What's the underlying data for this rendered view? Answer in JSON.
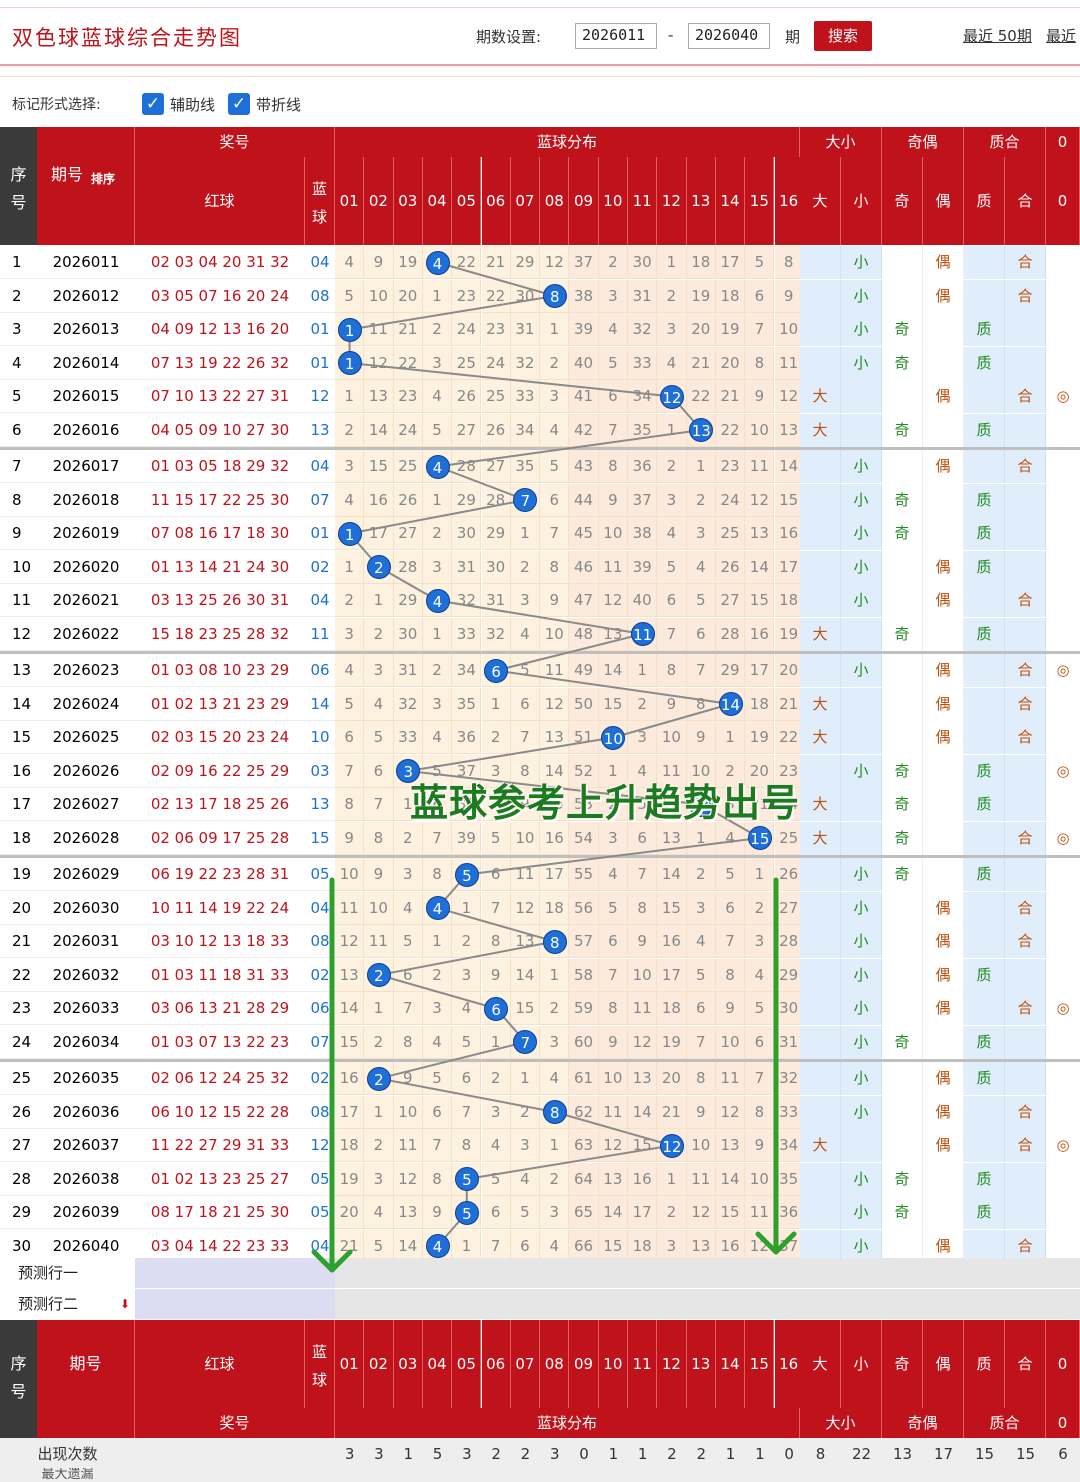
{
  "header": {
    "title": "双色球蓝球综合走势图",
    "period_label": "期数设置:",
    "from_value": "2026011",
    "dash": "-",
    "to_value": "2026040",
    "unit": "期",
    "search_label": "搜索",
    "recent_50": "最近 50期",
    "recent_more": "最近"
  },
  "marks": {
    "label": "标记形式选择:",
    "aux_label": "辅助线",
    "fold_label": "带折线"
  },
  "table_header": {
    "seq": "序号",
    "period": "期号",
    "sort": "排序",
    "prize": "奖号",
    "red": "红球",
    "blue": "蓝球",
    "dist": "蓝球分布",
    "size": "大小",
    "parity": "奇偶",
    "primality": "质合",
    "zero_col": "0",
    "big": "大",
    "small": "小",
    "odd": "奇",
    "even": "偶",
    "prime": "质",
    "comp": "合",
    "col_numbers": [
      "01",
      "02",
      "03",
      "04",
      "05",
      "06",
      "07",
      "08",
      "09",
      "10",
      "11",
      "12",
      "13",
      "14",
      "15",
      "16"
    ]
  },
  "rows": [
    {
      "seq": "1",
      "period": "2026011",
      "red": "02 03 04 20 31 32",
      "blue": "04",
      "dist": [
        "4",
        "9",
        "19",
        "4",
        "22",
        "21",
        "29",
        "12",
        "37",
        "2",
        "30",
        "1",
        "18",
        "17",
        "5",
        "8"
      ],
      "size": "小",
      "parity": "偶",
      "prime": "合",
      "z": ""
    },
    {
      "seq": "2",
      "period": "2026012",
      "red": "03 05 07 16 20 24",
      "blue": "08",
      "dist": [
        "5",
        "10",
        "20",
        "1",
        "23",
        "22",
        "30",
        "8",
        "38",
        "3",
        "31",
        "2",
        "19",
        "18",
        "6",
        "9"
      ],
      "size": "小",
      "parity": "偶",
      "prime": "合",
      "z": ""
    },
    {
      "seq": "3",
      "period": "2026013",
      "red": "04 09 12 13 16 20",
      "blue": "01",
      "dist": [
        "1",
        "11",
        "21",
        "2",
        "24",
        "23",
        "31",
        "1",
        "39",
        "4",
        "32",
        "3",
        "20",
        "19",
        "7",
        "10"
      ],
      "size": "小",
      "parity": "奇",
      "prime": "质",
      "z": ""
    },
    {
      "seq": "4",
      "period": "2026014",
      "red": "07 13 19 22 26 32",
      "blue": "01",
      "dist": [
        "1",
        "12",
        "22",
        "3",
        "25",
        "24",
        "32",
        "2",
        "40",
        "5",
        "33",
        "4",
        "21",
        "20",
        "8",
        "11"
      ],
      "size": "小",
      "parity": "奇",
      "prime": "质",
      "z": ""
    },
    {
      "seq": "5",
      "period": "2026015",
      "red": "07 10 13 22 27 31",
      "blue": "12",
      "dist": [
        "1",
        "13",
        "23",
        "4",
        "26",
        "25",
        "33",
        "3",
        "41",
        "6",
        "34",
        "12",
        "22",
        "21",
        "9",
        "12"
      ],
      "size": "大",
      "parity": "偶",
      "prime": "合",
      "z": "◎"
    },
    {
      "seq": "6",
      "period": "2026016",
      "red": "04 05 09 10 27 30",
      "blue": "13",
      "dist": [
        "2",
        "14",
        "24",
        "5",
        "27",
        "26",
        "34",
        "4",
        "42",
        "7",
        "35",
        "1",
        "13",
        "22",
        "10",
        "13"
      ],
      "size": "大",
      "parity": "奇",
      "prime": "质",
      "z": ""
    },
    {
      "seq": "7",
      "period": "2026017",
      "red": "01 03 05 18 29 32",
      "blue": "04",
      "dist": [
        "3",
        "15",
        "25",
        "4",
        "28",
        "27",
        "35",
        "5",
        "43",
        "8",
        "36",
        "2",
        "1",
        "23",
        "11",
        "14"
      ],
      "size": "小",
      "parity": "偶",
      "prime": "合",
      "z": ""
    },
    {
      "seq": "8",
      "period": "2026018",
      "red": "11 15 17 22 25 30",
      "blue": "07",
      "dist": [
        "4",
        "16",
        "26",
        "1",
        "29",
        "28",
        "7",
        "6",
        "44",
        "9",
        "37",
        "3",
        "2",
        "24",
        "12",
        "15"
      ],
      "size": "小",
      "parity": "奇",
      "prime": "质",
      "z": ""
    },
    {
      "seq": "9",
      "period": "2026019",
      "red": "07 08 16 17 18 30",
      "blue": "01",
      "dist": [
        "1",
        "17",
        "27",
        "2",
        "30",
        "29",
        "1",
        "7",
        "45",
        "10",
        "38",
        "4",
        "3",
        "25",
        "13",
        "16"
      ],
      "size": "小",
      "parity": "奇",
      "prime": "质",
      "z": ""
    },
    {
      "seq": "10",
      "period": "2026020",
      "red": "01 13 14 21 24 30",
      "blue": "02",
      "dist": [
        "1",
        "2",
        "28",
        "3",
        "31",
        "30",
        "2",
        "8",
        "46",
        "11",
        "39",
        "5",
        "4",
        "26",
        "14",
        "17"
      ],
      "size": "小",
      "parity": "偶",
      "prime": "质",
      "z": ""
    },
    {
      "seq": "11",
      "period": "2026021",
      "red": "03 13 25 26 30 31",
      "blue": "04",
      "dist": [
        "2",
        "1",
        "29",
        "4",
        "32",
        "31",
        "3",
        "9",
        "47",
        "12",
        "40",
        "6",
        "5",
        "27",
        "15",
        "18"
      ],
      "size": "小",
      "parity": "偶",
      "prime": "合",
      "z": ""
    },
    {
      "seq": "12",
      "period": "2026022",
      "red": "15 18 23 25 28 32",
      "blue": "11",
      "dist": [
        "3",
        "2",
        "30",
        "1",
        "33",
        "32",
        "4",
        "10",
        "48",
        "13",
        "11",
        "7",
        "6",
        "28",
        "16",
        "19"
      ],
      "size": "大",
      "parity": "奇",
      "prime": "质",
      "z": ""
    },
    {
      "seq": "13",
      "period": "2026023",
      "red": "01 03 08 10 23 29",
      "blue": "06",
      "dist": [
        "4",
        "3",
        "31",
        "2",
        "34",
        "6",
        "5",
        "11",
        "49",
        "14",
        "1",
        "8",
        "7",
        "29",
        "17",
        "20"
      ],
      "size": "小",
      "parity": "偶",
      "prime": "合",
      "z": "◎"
    },
    {
      "seq": "14",
      "period": "2026024",
      "red": "01 02 13 21 23 29",
      "blue": "14",
      "dist": [
        "5",
        "4",
        "32",
        "3",
        "35",
        "1",
        "6",
        "12",
        "50",
        "15",
        "2",
        "9",
        "8",
        "14",
        "18",
        "21"
      ],
      "size": "大",
      "parity": "偶",
      "prime": "合",
      "z": ""
    },
    {
      "seq": "15",
      "period": "2026025",
      "red": "02 03 15 20 23 24",
      "blue": "10",
      "dist": [
        "6",
        "5",
        "33",
        "4",
        "36",
        "2",
        "7",
        "13",
        "51",
        "10",
        "3",
        "10",
        "9",
        "1",
        "19",
        "22"
      ],
      "size": "大",
      "parity": "偶",
      "prime": "合",
      "z": ""
    },
    {
      "seq": "16",
      "period": "2026026",
      "red": "02 09 16 22 25 29",
      "blue": "03",
      "dist": [
        "7",
        "6",
        "3",
        "5",
        "37",
        "3",
        "8",
        "14",
        "52",
        "1",
        "4",
        "11",
        "10",
        "2",
        "20",
        "23"
      ],
      "size": "小",
      "parity": "奇",
      "prime": "质",
      "z": "◎"
    },
    {
      "seq": "17",
      "period": "2026027",
      "red": "02 13 17 18 25 26",
      "blue": "13",
      "dist": [
        "8",
        "7",
        "1",
        "6",
        "38",
        "4",
        "9",
        "15",
        "53",
        "2",
        "5",
        "12",
        "13",
        "3",
        "21",
        "24"
      ],
      "size": "大",
      "parity": "奇",
      "prime": "质",
      "z": ""
    },
    {
      "seq": "18",
      "period": "2026028",
      "red": "02 06 09 17 25 28",
      "blue": "15",
      "dist": [
        "9",
        "8",
        "2",
        "7",
        "39",
        "5",
        "10",
        "16",
        "54",
        "3",
        "6",
        "13",
        "1",
        "4",
        "15",
        "25"
      ],
      "size": "大",
      "parity": "奇",
      "prime": "合",
      "z": "◎"
    },
    {
      "seq": "19",
      "period": "2026029",
      "red": "06 19 22 23 28 31",
      "blue": "05",
      "dist": [
        "10",
        "9",
        "3",
        "8",
        "5",
        "6",
        "11",
        "17",
        "55",
        "4",
        "7",
        "14",
        "2",
        "5",
        "1",
        "26"
      ],
      "size": "小",
      "parity": "奇",
      "prime": "质",
      "z": ""
    },
    {
      "seq": "20",
      "period": "2026030",
      "red": "10 11 14 19 22 24",
      "blue": "04",
      "dist": [
        "11",
        "10",
        "4",
        "4",
        "1",
        "7",
        "12",
        "18",
        "56",
        "5",
        "8",
        "15",
        "3",
        "6",
        "2",
        "27"
      ],
      "size": "小",
      "parity": "偶",
      "prime": "合",
      "z": ""
    },
    {
      "seq": "21",
      "period": "2026031",
      "red": "03 10 12 13 18 33",
      "blue": "08",
      "dist": [
        "12",
        "11",
        "5",
        "1",
        "2",
        "8",
        "13",
        "8",
        "57",
        "6",
        "9",
        "16",
        "4",
        "7",
        "3",
        "28"
      ],
      "size": "小",
      "parity": "偶",
      "prime": "合",
      "z": ""
    },
    {
      "seq": "22",
      "period": "2026032",
      "red": "01 03 11 18 31 33",
      "blue": "02",
      "dist": [
        "13",
        "2",
        "6",
        "2",
        "3",
        "9",
        "14",
        "1",
        "58",
        "7",
        "10",
        "17",
        "5",
        "8",
        "4",
        "29"
      ],
      "size": "小",
      "parity": "偶",
      "prime": "质",
      "z": ""
    },
    {
      "seq": "23",
      "period": "2026033",
      "red": "03 06 13 21 28 29",
      "blue": "06",
      "dist": [
        "14",
        "1",
        "7",
        "3",
        "4",
        "6",
        "15",
        "2",
        "59",
        "8",
        "11",
        "18",
        "6",
        "9",
        "5",
        "30"
      ],
      "size": "小",
      "parity": "偶",
      "prime": "合",
      "z": "◎"
    },
    {
      "seq": "24",
      "period": "2026034",
      "red": "01 03 07 13 22 23",
      "blue": "07",
      "dist": [
        "15",
        "2",
        "8",
        "4",
        "5",
        "1",
        "7",
        "3",
        "60",
        "9",
        "12",
        "19",
        "7",
        "10",
        "6",
        "31"
      ],
      "size": "小",
      "parity": "奇",
      "prime": "质",
      "z": ""
    },
    {
      "seq": "25",
      "period": "2026035",
      "red": "02 06 12 24 25 32",
      "blue": "02",
      "dist": [
        "16",
        "2",
        "9",
        "5",
        "6",
        "2",
        "1",
        "4",
        "61",
        "10",
        "13",
        "20",
        "8",
        "11",
        "7",
        "32"
      ],
      "size": "小",
      "parity": "偶",
      "prime": "质",
      "z": ""
    },
    {
      "seq": "26",
      "period": "2026036",
      "red": "06 10 12 15 22 28",
      "blue": "08",
      "dist": [
        "17",
        "1",
        "10",
        "6",
        "7",
        "3",
        "2",
        "8",
        "62",
        "11",
        "14",
        "21",
        "9",
        "12",
        "8",
        "33"
      ],
      "size": "小",
      "parity": "偶",
      "prime": "合",
      "z": ""
    },
    {
      "seq": "27",
      "period": "2026037",
      "red": "11 22 27 29 31 33",
      "blue": "12",
      "dist": [
        "18",
        "2",
        "11",
        "7",
        "8",
        "4",
        "3",
        "1",
        "63",
        "12",
        "15",
        "12",
        "10",
        "13",
        "9",
        "34"
      ],
      "size": "大",
      "parity": "偶",
      "prime": "合",
      "z": "◎"
    },
    {
      "seq": "28",
      "period": "2026038",
      "red": "01 02 13 23 25 27",
      "blue": "05",
      "dist": [
        "19",
        "3",
        "12",
        "8",
        "5",
        "5",
        "4",
        "2",
        "64",
        "13",
        "16",
        "1",
        "11",
        "14",
        "10",
        "35"
      ],
      "size": "小",
      "parity": "奇",
      "prime": "质",
      "z": ""
    },
    {
      "seq": "29",
      "period": "2026039",
      "red": "08 17 18 21 25 30",
      "blue": "05",
      "dist": [
        "20",
        "4",
        "13",
        "9",
        "5",
        "6",
        "5",
        "3",
        "65",
        "14",
        "17",
        "2",
        "12",
        "15",
        "11",
        "36"
      ],
      "size": "小",
      "parity": "奇",
      "prime": "质",
      "z": ""
    },
    {
      "seq": "30",
      "period": "2026040",
      "red": "03 04 14 22 23 33",
      "blue": "04",
      "dist": [
        "21",
        "5",
        "14",
        "4",
        "1",
        "7",
        "6",
        "4",
        "66",
        "15",
        "18",
        "3",
        "13",
        "16",
        "12",
        "37"
      ],
      "size": "小",
      "parity": "偶",
      "prime": "合",
      "z": ""
    }
  ],
  "predict": {
    "row1": "预测行一",
    "row2": "预测行二"
  },
  "footer": {
    "seq": "序号",
    "period": "期号",
    "red": "红球",
    "blue": "蓝球",
    "prize": "奖号",
    "dist": "蓝球分布",
    "size": "大小",
    "parity": "奇偶",
    "primality": "质合",
    "zero_col": "0",
    "occurrence_label": "出现次数",
    "occurrences": [
      "3",
      "3",
      "1",
      "5",
      "3",
      "2",
      "2",
      "3",
      "0",
      "1",
      "1",
      "2",
      "2",
      "1",
      "1",
      "0",
      "8",
      "22",
      "13",
      "17",
      "15",
      "15",
      "6"
    ],
    "max_miss_label": "最大遗漏"
  },
  "annotation": "蓝球参考上升趋势出号",
  "colors": {
    "brand_red": "#c0121b",
    "ball_blue": "#1f6fd8",
    "arrow_green": "#2ea02e"
  }
}
